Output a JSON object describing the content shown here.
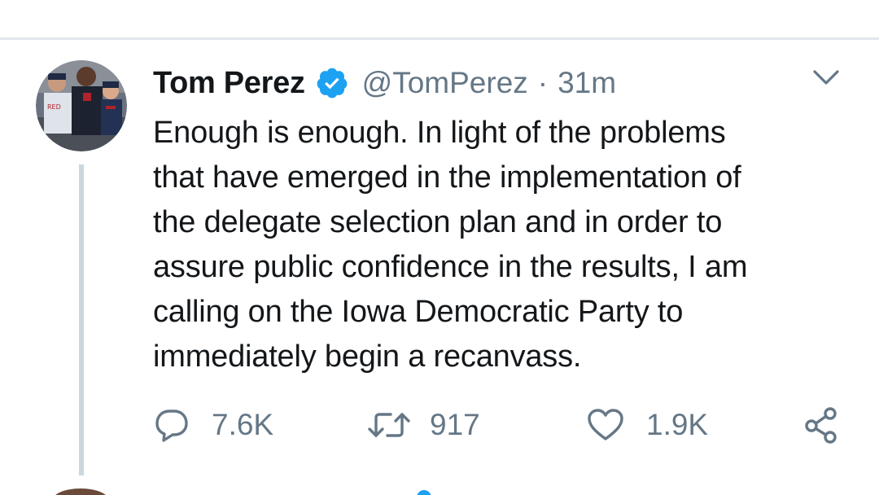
{
  "tweet": {
    "display_name": "Tom Perez",
    "handle": "@TomPerez",
    "separator": "·",
    "time": "31m",
    "text": "Enough is enough. In light of the problems\nthat have emerged in the implementation of\nthe delegate selection plan and in order to\nassure public confidence in the results, I am\ncalling on the Iowa Democratic Party to\nimmediately begin a recanvass.",
    "verified": true
  },
  "actions": {
    "reply_count": "7.6K",
    "retweet_count": "917",
    "like_count": "1.9K"
  },
  "icons": {
    "verified": "verified-badge-icon",
    "more": "chevron-down-icon",
    "reply": "reply-bubble-icon",
    "retweet": "retweet-icon",
    "like": "heart-icon",
    "share": "share-icon"
  },
  "colors": {
    "text_primary": "#14171a",
    "text_secondary": "#657786",
    "verified_blue": "#1da1f2",
    "divider": "#e1e8ed",
    "thread_line": "#ccd6dd"
  }
}
